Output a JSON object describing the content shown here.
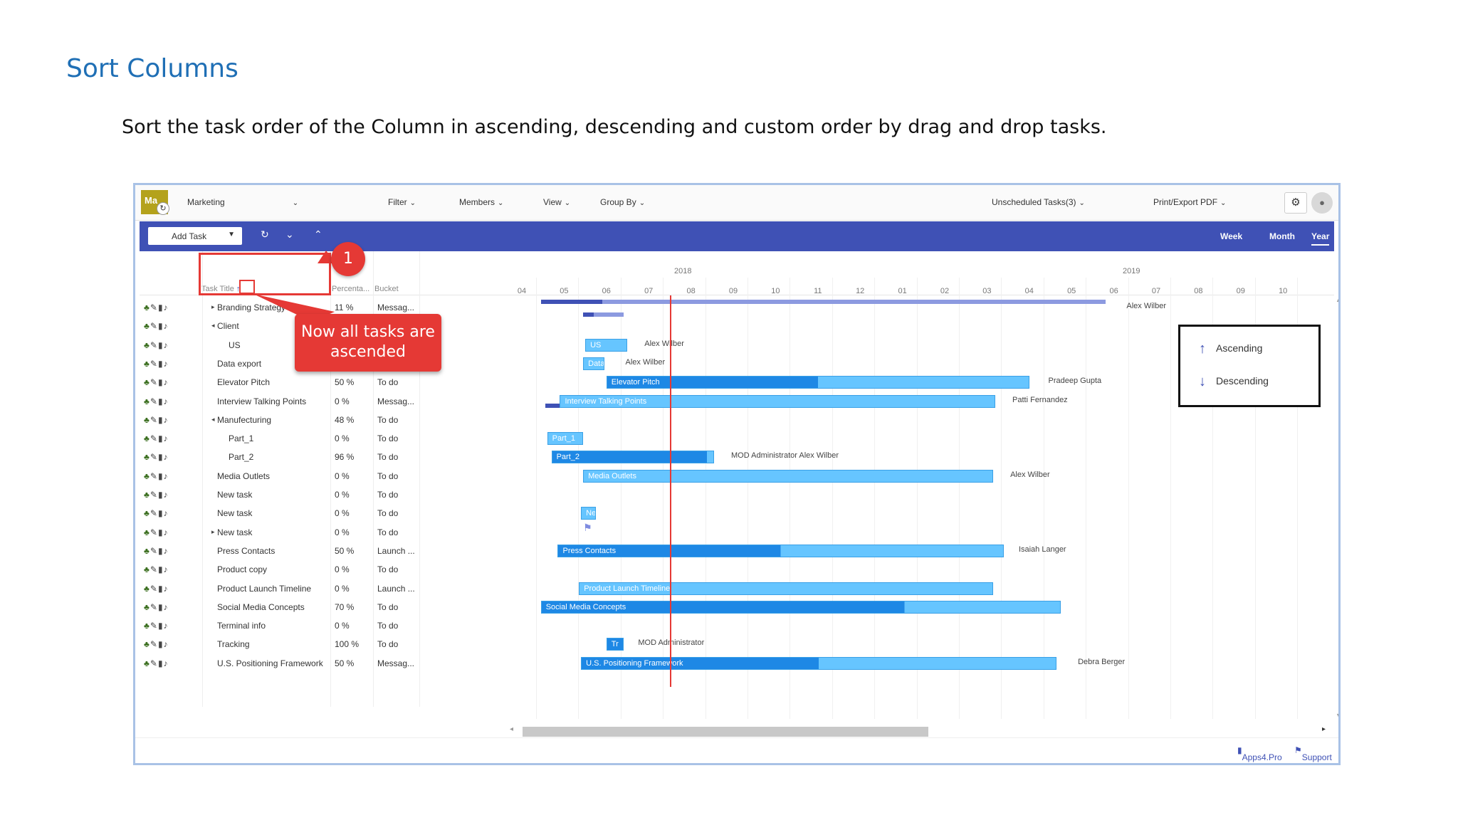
{
  "doc": {
    "title": "Sort Columns",
    "description": "Sort the task order of the Column in ascending, descending and custom order by drag and drop tasks."
  },
  "toolbar": {
    "logo": "Ma",
    "plan": "Marketing",
    "filter": "Filter",
    "members": "Members",
    "view": "View",
    "group_by": "Group By",
    "unscheduled": "Unscheduled Tasks(3)",
    "print": "Print/Export PDF"
  },
  "bluebar": {
    "add_task": "Add Task",
    "week": "Week",
    "month": "Month",
    "year": "Year"
  },
  "grid": {
    "headers": {
      "title": "Task Title",
      "percent": "Percenta...",
      "bucket": "Bucket",
      "sort_arrow": "↑"
    },
    "rows": [
      {
        "title": "Branding Strategy",
        "pct": "11 %",
        "bucket": "Messag...",
        "caret": "▸",
        "indent": 0
      },
      {
        "title": "Client",
        "pct": "",
        "bucket": "",
        "caret": "◂",
        "indent": 0
      },
      {
        "title": "US",
        "pct": "",
        "bucket": "",
        "caret": "",
        "indent": 1
      },
      {
        "title": "Data export",
        "pct": "",
        "bucket": "",
        "caret": "",
        "indent": 0
      },
      {
        "title": "Elevator Pitch",
        "pct": "50 %",
        "bucket": "To do",
        "caret": "",
        "indent": 0
      },
      {
        "title": "Interview Talking Points",
        "pct": "0 %",
        "bucket": "Messag...",
        "caret": "",
        "indent": 0
      },
      {
        "title": "Manufecturing",
        "pct": "48 %",
        "bucket": "To do",
        "caret": "◂",
        "indent": 0
      },
      {
        "title": "Part_1",
        "pct": "0 %",
        "bucket": "To do",
        "caret": "",
        "indent": 1
      },
      {
        "title": "Part_2",
        "pct": "96 %",
        "bucket": "To do",
        "caret": "",
        "indent": 1
      },
      {
        "title": "Media Outlets",
        "pct": "0 %",
        "bucket": "To do",
        "caret": "",
        "indent": 0
      },
      {
        "title": "New task",
        "pct": "0 %",
        "bucket": "To do",
        "caret": "",
        "indent": 0
      },
      {
        "title": "New task",
        "pct": "0 %",
        "bucket": "To do",
        "caret": "",
        "indent": 0
      },
      {
        "title": "New task",
        "pct": "0 %",
        "bucket": "To do",
        "caret": "▸",
        "indent": 0
      },
      {
        "title": "Press Contacts",
        "pct": "50 %",
        "bucket": "Launch ...",
        "caret": "",
        "indent": 0
      },
      {
        "title": "Product copy",
        "pct": "0 %",
        "bucket": "To do",
        "caret": "",
        "indent": 0
      },
      {
        "title": "Product Launch Timeline",
        "pct": "0 %",
        "bucket": "Launch ...",
        "caret": "",
        "indent": 0
      },
      {
        "title": "Social Media Concepts",
        "pct": "70 %",
        "bucket": "To do",
        "caret": "",
        "indent": 0
      },
      {
        "title": "Terminal info",
        "pct": "0 %",
        "bucket": "To do",
        "caret": "",
        "indent": 0
      },
      {
        "title": "Tracking",
        "pct": "100 %",
        "bucket": "To do",
        "caret": "",
        "indent": 0
      },
      {
        "title": "U.S. Positioning Framework",
        "pct": "50 %",
        "bucket": "Messag...",
        "caret": "",
        "indent": 0
      }
    ]
  },
  "chart": {
    "years": [
      "2018",
      "2019"
    ],
    "months": [
      "04",
      "05",
      "06",
      "07",
      "08",
      "09",
      "10",
      "11",
      "12",
      "01",
      "02",
      "03",
      "04",
      "05",
      "06",
      "07",
      "08",
      "09",
      "10"
    ],
    "bars": [
      {
        "label": "US",
        "style": "light",
        "row": 2,
        "start": 1.5,
        "end": 2.5,
        "progress": 0
      },
      {
        "label": "Data",
        "style": "light",
        "row": 3,
        "start": 1.45,
        "end": 1.95,
        "progress": 0
      },
      {
        "label": "Elevator Pitch",
        "style": "light",
        "row": 4,
        "start": 2.0,
        "end": 12.0,
        "progress": 0.5
      },
      {
        "label": "Interview Talking Points",
        "style": "light",
        "row": 5,
        "start": 0.9,
        "end": 11.2,
        "progress": 0
      },
      {
        "label": "Part_1",
        "style": "light",
        "row": 7,
        "start": 0.6,
        "end": 1.45,
        "progress": 0
      },
      {
        "label": "Part_2",
        "style": "light",
        "row": 8,
        "start": 0.7,
        "end": 4.55,
        "progress": 0.96
      },
      {
        "label": "Media Outlets",
        "style": "light",
        "row": 9,
        "start": 1.45,
        "end": 11.15,
        "progress": 0
      },
      {
        "label": "Ne",
        "style": "light",
        "row": 11,
        "start": 1.4,
        "end": 1.75,
        "progress": 0
      },
      {
        "label": "Press Contacts",
        "style": "light",
        "row": 13,
        "start": 0.85,
        "end": 11.4,
        "progress": 0.5
      },
      {
        "label": "Product Launch Timeline",
        "style": "light",
        "row": 15,
        "start": 1.35,
        "end": 11.15,
        "progress": 0
      },
      {
        "label": "Social Media Concepts",
        "style": "light",
        "row": 16,
        "start": 0.45,
        "end": 12.75,
        "progress": 0.7
      },
      {
        "label": "Tr",
        "style": "light",
        "row": 18,
        "start": 2.0,
        "end": 2.4,
        "progress": 1.0
      },
      {
        "label": "U.S. Positioning Framework",
        "style": "light",
        "row": 19,
        "start": 1.4,
        "end": 12.65,
        "progress": 0.5
      }
    ],
    "assignees": [
      {
        "text": "Alex Wilber",
        "row": 0,
        "at": 14.3
      },
      {
        "text": "Alex Wilber",
        "row": 2,
        "at": 2.9
      },
      {
        "text": "Alex Wilber",
        "row": 3,
        "at": 2.45
      },
      {
        "text": "Pradeep Gupta",
        "row": 4,
        "at": 12.45
      },
      {
        "text": "Patti Fernandez",
        "row": 5,
        "at": 11.6
      },
      {
        "text": "MOD Administrator  Alex Wilber",
        "row": 8,
        "at": 4.95
      },
      {
        "text": "Alex Wilber",
        "row": 9,
        "at": 11.55
      },
      {
        "text": "Isaiah Langer",
        "row": 13,
        "at": 11.75
      },
      {
        "text": "MOD Administrator",
        "row": 18,
        "at": 2.75
      },
      {
        "text": "Debra Berger",
        "row": 19,
        "at": 13.15
      }
    ],
    "today": 3.5
  },
  "legend": {
    "ascending": "Ascending",
    "descending": "Descending"
  },
  "callouts": {
    "number": "1",
    "message": "Now all tasks are ascended"
  },
  "footer": {
    "apps4pro": "Apps4.Pro",
    "support": "Support"
  },
  "colors": {
    "accent": "#3f51b5",
    "bar_light": "#66c5ff",
    "bar_dark": "#1e88e5",
    "callout": "#e53935",
    "today_line": "#e53935"
  }
}
